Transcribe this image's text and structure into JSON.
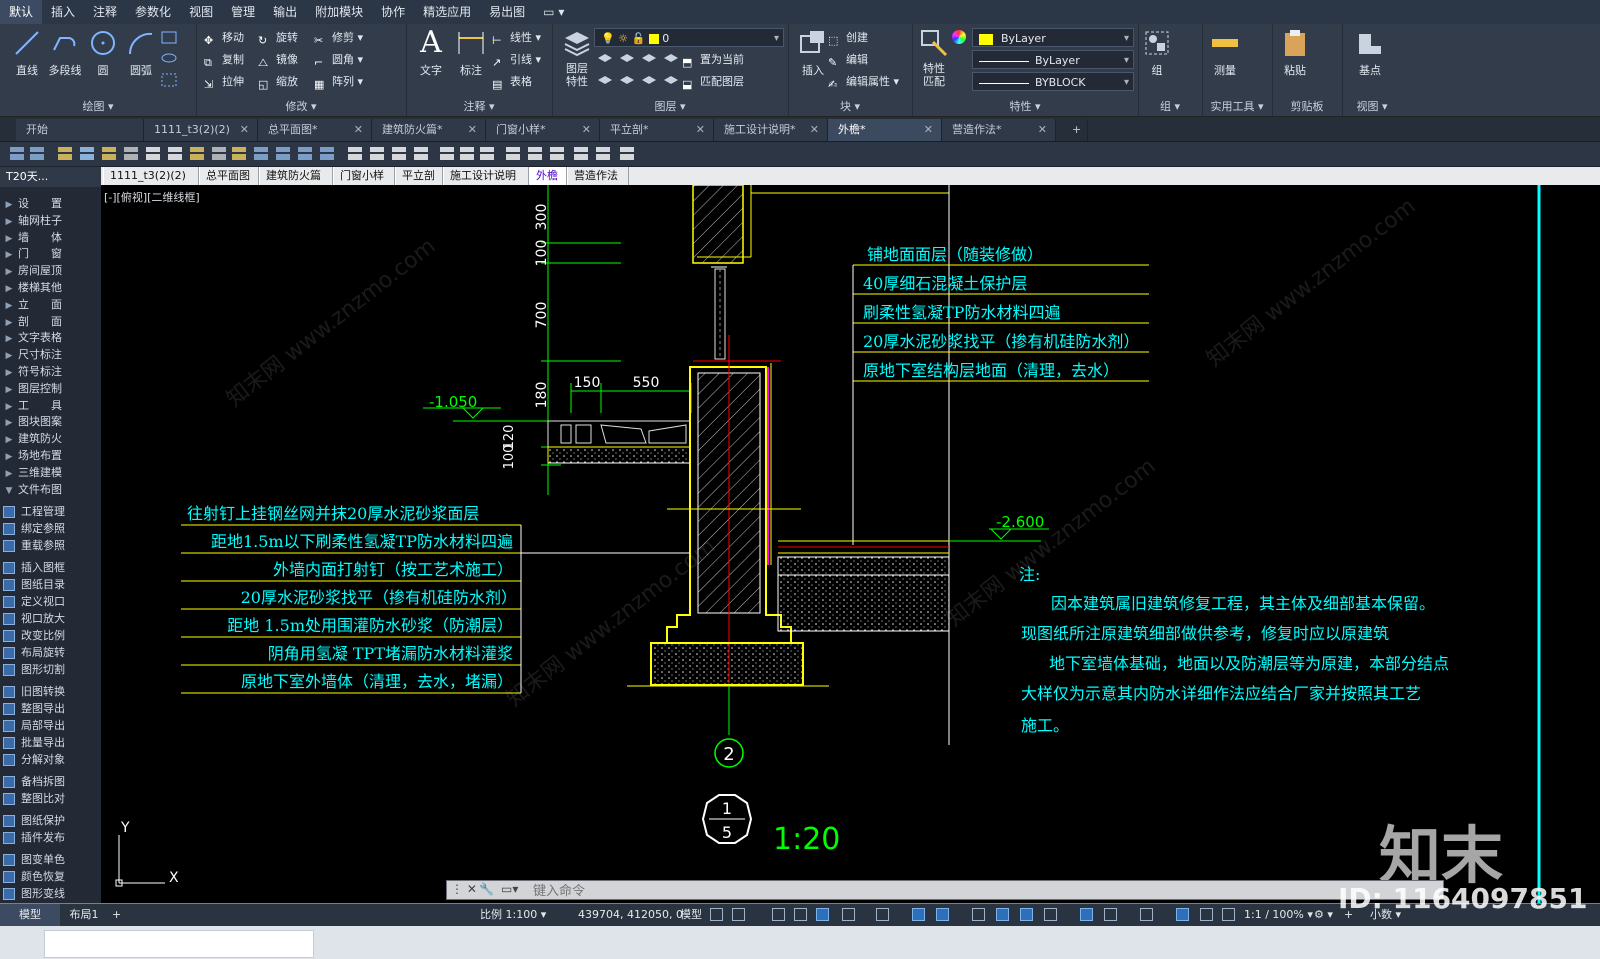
{
  "menu": {
    "items": [
      "默认",
      "插入",
      "注释",
      "参数化",
      "视图",
      "管理",
      "输出",
      "附加模块",
      "协作",
      "精选应用",
      "易出图"
    ],
    "active": "默认"
  },
  "ribbon": {
    "draw": {
      "title": "绘图",
      "tools": [
        "直线",
        "多段线",
        "圆",
        "圆弧"
      ]
    },
    "modify": {
      "title": "修改",
      "tools": [
        "移动",
        "旋转",
        "修剪",
        "复制",
        "镜像",
        "圆角",
        "拉伸",
        "缩放",
        "阵列"
      ]
    },
    "annotation": {
      "title": "注释",
      "text": "文字",
      "dim": "标注",
      "tools": [
        "线性",
        "引线",
        "表格"
      ]
    },
    "layers": {
      "title": "图层",
      "feature": "图层\n特性",
      "layer_value": "0",
      "tools": [
        "置为当前",
        "匹配图层"
      ]
    },
    "block": {
      "title": "块",
      "insert": "插入",
      "tools": [
        "创建",
        "编辑",
        "编辑属性"
      ]
    },
    "properties": {
      "title": "特性",
      "match": "特性\n匹配",
      "color": "ByLayer",
      "linetype": "ByLayer",
      "lineweight": "BYBLOCK"
    },
    "groups": {
      "title": "组",
      "label": "组"
    },
    "utilities": {
      "title": "实用工具",
      "measure": "测量"
    },
    "clipboard": {
      "title": "剪贴板",
      "paste": "粘贴"
    },
    "view": {
      "title": "视图",
      "base": "基点"
    }
  },
  "file_tabs": [
    {
      "label": "开始",
      "closable": false
    },
    {
      "label": "1111_t3(2)(2)",
      "closable": true
    },
    {
      "label": "总平面图*",
      "closable": true
    },
    {
      "label": "建筑防火篇*",
      "closable": true
    },
    {
      "label": "门窗小样*",
      "closable": true
    },
    {
      "label": "平立剖*",
      "closable": true
    },
    {
      "label": "施工设计说明*",
      "closable": true
    },
    {
      "label": "外檐*",
      "closable": true,
      "active": true
    },
    {
      "label": "营造作法*",
      "closable": true
    }
  ],
  "palette": {
    "title": "T20天...",
    "groups": [
      "设　　置",
      "轴网柱子",
      "墙　　体",
      "门　　窗",
      "房间屋顶",
      "楼梯其他",
      "立　　面",
      "剖　　面",
      "文字表格",
      "尺寸标注",
      "符号标注",
      "图层控制",
      "工　　具",
      "图块图案",
      "建筑防火",
      "场地布置",
      "三维建模",
      "文件布图"
    ],
    "commands": [
      "工程管理",
      "绑定参照",
      "重载参照",
      "插入图框",
      "图纸目录",
      "定义视口",
      "视口放大",
      "改变比例",
      "布局旋转",
      "图形切割",
      "旧图转换",
      "整图导出",
      "局部导出",
      "批量导出",
      "分解对象",
      "备档拆图",
      "整图比对",
      "图纸保护",
      "插件发布",
      "图变单色",
      "颜色恢复",
      "图形变线"
    ]
  },
  "sheet_tabs": [
    "1111_t3(2)(2)",
    "总平面图",
    "建筑防火篇",
    "门窗小样",
    "平立剖",
    "施工设计说明",
    "外檐",
    "营造作法"
  ],
  "active_sheet": "外檐",
  "viewport_label": "[-][俯视][二维线框]",
  "drawing": {
    "dims_vertical": [
      "300",
      "100",
      "700",
      "180",
      "120",
      "100"
    ],
    "dims_horizontal": [
      "150",
      "550"
    ],
    "levels": [
      "-1.050",
      "-2.600"
    ],
    "right_callouts": [
      "铺地面面层（随装修做）",
      "40厚细石混凝土保护层",
      "刷柔性氢凝TP防水材料四遍",
      "20厚水泥砂浆找平（掺有机硅防水剂）",
      "原地下室结构层地面（清理，去水）"
    ],
    "left_callouts": [
      "往射钉上挂钢丝网并抹20厚水泥砂浆面层",
      "距地1.5m以下刷柔性氢凝TP防水材料四遍",
      "外墙内面打射钉（按工艺术施工）",
      "20厚水泥砂浆找平（掺有机硅防水剂）",
      "距地 1.5m处用围灌防水砂浆（防潮层）",
      "阴角用氢凝 TPT堵漏防水材料灌浆",
      "原地下室外墙体（清理，去水，堵漏）"
    ],
    "note_title": "注:",
    "note_lines": [
      "因本建筑属旧建筑修复工程，其主体及细部基本保留。",
      "现图纸所注原建筑细部做供参考，修复时应以原建筑",
      "地下室墙体基础，地面以及防潮层等为原建，本部分结点",
      "大样仅为示意其内防水详细作法应结合厂家并按照其工艺",
      "施工。"
    ],
    "axis_label": "2",
    "detail_top": "1",
    "detail_bottom": "5",
    "scale": "1:20",
    "ucs_x": "X",
    "ucs_y": "Y"
  },
  "command": {
    "placeholder": "键入命令"
  },
  "status": {
    "tabs": [
      "模型",
      "布局1"
    ],
    "scale": "比例 1:100",
    "coords": "439704, 412050, 0",
    "space": "模型",
    "annotation_scale": "1:1 / 100%",
    "units": "小数"
  },
  "watermarks": [
    "知末网 www.znzmo.com",
    "知末",
    "ID: 1164097851"
  ],
  "colors": {
    "canvas": "#000000",
    "cad_yellow": "#ffff00",
    "cad_cyan": "#00ffff",
    "cad_green": "#00ff00",
    "cad_red": "#ff0000",
    "cad_magenta": "#ff00ff",
    "ribbon": "#323c4b",
    "menubar": "#2b3646"
  }
}
